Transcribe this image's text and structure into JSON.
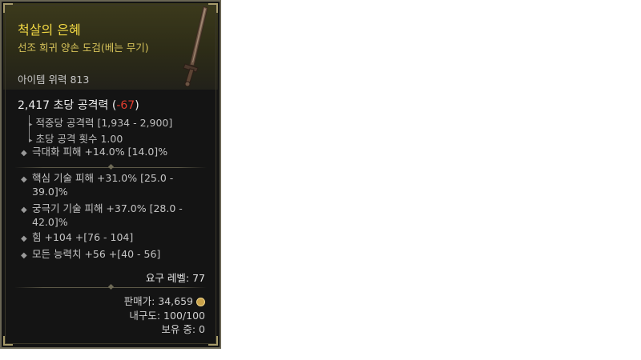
{
  "item": {
    "name": "척살의 은혜",
    "type": "선조 희귀 양손 도검(베는 무기)",
    "power": "아이템 위력 813"
  },
  "dps": {
    "value": "2,417 초당 공격력",
    "delta_open": "(",
    "delta": "-67",
    "delta_close": ")"
  },
  "sub_stats": [
    "적중당 공격력 [1,934 - 2,900]",
    "초당 공격 횟수 1.00"
  ],
  "implicit_stat": "극대화 피해 +14.0% [14.0]%",
  "affixes": [
    "핵심 기술 피해 +31.0% [25.0 - 39.0]%",
    "궁극기 기술 피해 +37.0% [28.0 - 42.0]%",
    "힘 +104 +[76 - 104]",
    "모든 능력치 +56 +[40 - 56]"
  ],
  "requirement": "요구 레벨: 77",
  "sell_price": "판매가: 34,659",
  "durability": "내구도: 100/100",
  "owned": "보유 중: 0",
  "colors": {
    "name": "#f0d743",
    "type": "#d7c35a",
    "delta": "#e33d2f",
    "header_bg": "#3c3a1c",
    "border": "#6a6655"
  },
  "icons": {
    "weapon": "greatsword-icon",
    "currency": "gold-coin-icon"
  }
}
